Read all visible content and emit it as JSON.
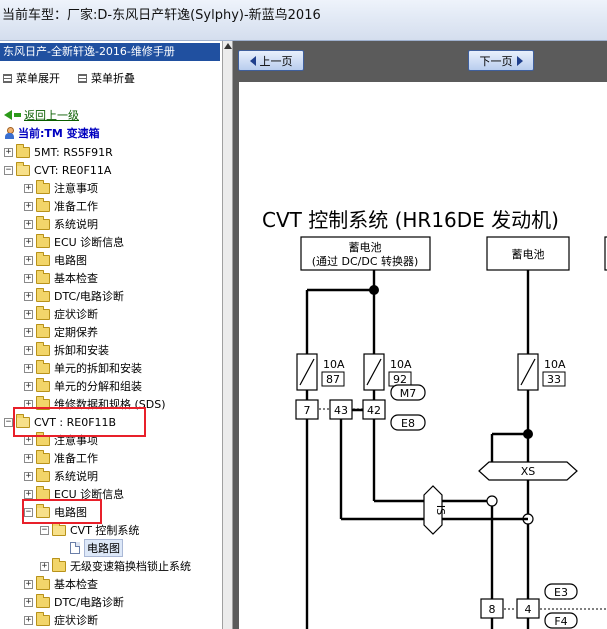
{
  "window": {
    "title": "当前车型：厂家:D-东风日产轩逸(Sylphy)-新蓝鸟2016"
  },
  "nav": {
    "manual_title": "东风日产-全新轩逸-2016-维修手册",
    "expand_label": "菜单展开",
    "collapse_label": "菜单折叠",
    "back_label": "返回上一级",
    "current_label": "当前:TM 变速箱",
    "tree": [
      {
        "label": "5MT: RS5F91R",
        "level": 0,
        "toggle": "+",
        "icon": "folder"
      },
      {
        "label": "CVT: RE0F11A",
        "level": 0,
        "toggle": "-",
        "icon": "folder-open"
      },
      {
        "label": "注意事项",
        "level": 1,
        "toggle": "+",
        "icon": "folder"
      },
      {
        "label": "准备工作",
        "level": 1,
        "toggle": "+",
        "icon": "folder"
      },
      {
        "label": "系统说明",
        "level": 1,
        "toggle": "+",
        "icon": "folder"
      },
      {
        "label": "ECU 诊断信息",
        "level": 1,
        "toggle": "+",
        "icon": "folder"
      },
      {
        "label": "电路图",
        "level": 1,
        "toggle": "+",
        "icon": "folder"
      },
      {
        "label": "基本检查",
        "level": 1,
        "toggle": "+",
        "icon": "folder"
      },
      {
        "label": "DTC/电路诊断",
        "level": 1,
        "toggle": "+",
        "icon": "folder"
      },
      {
        "label": "症状诊断",
        "level": 1,
        "toggle": "+",
        "icon": "folder"
      },
      {
        "label": "定期保养",
        "level": 1,
        "toggle": "+",
        "icon": "folder"
      },
      {
        "label": "拆卸和安装",
        "level": 1,
        "toggle": "+",
        "icon": "folder"
      },
      {
        "label": "单元的拆卸和安装",
        "level": 1,
        "toggle": "+",
        "icon": "folder"
      },
      {
        "label": "单元的分解和组装",
        "level": 1,
        "toggle": "+",
        "icon": "folder"
      },
      {
        "label": "维修数据和规格 (SDS)",
        "level": 1,
        "toggle": "+",
        "icon": "folder"
      },
      {
        "label": "CVT : RE0F11B",
        "level": 0,
        "toggle": "-",
        "icon": "folder-open"
      },
      {
        "label": "注意事项",
        "level": 1,
        "toggle": "+",
        "icon": "folder"
      },
      {
        "label": "准备工作",
        "level": 1,
        "toggle": "+",
        "icon": "folder"
      },
      {
        "label": "系统说明",
        "level": 1,
        "toggle": "+",
        "icon": "folder"
      },
      {
        "label": "ECU 诊断信息",
        "level": 1,
        "toggle": "+",
        "icon": "folder"
      },
      {
        "label": "电路图",
        "level": 1,
        "toggle": "-",
        "icon": "folder-open"
      },
      {
        "label": "CVT 控制系统",
        "level": 2,
        "toggle": "-",
        "icon": "folder-open"
      },
      {
        "label": "电路图",
        "level": 3,
        "toggle": "",
        "icon": "doc",
        "selected": true
      },
      {
        "label": "无级变速箱换档锁止系统",
        "level": 2,
        "toggle": "+",
        "icon": "folder"
      },
      {
        "label": "基本检查",
        "level": 1,
        "toggle": "+",
        "icon": "folder"
      },
      {
        "label": "DTC/电路诊断",
        "level": 1,
        "toggle": "+",
        "icon": "folder"
      },
      {
        "label": "症状诊断",
        "level": 1,
        "toggle": "+",
        "icon": "folder"
      }
    ]
  },
  "toolbar": {
    "prev_label": "上一页",
    "next_label": "下一页"
  },
  "diagram": {
    "title": "CVT 控制系统 (HR16DE 发动机)",
    "battery1_line1": "蓄电池",
    "battery1_line2": "(通过 DC/DC 转换器)",
    "battery2": "蓄电池",
    "fuse1_amp": "10A",
    "fuse1_no": "87",
    "fuse2_amp": "10A",
    "fuse2_no": "92",
    "fuse3_amp": "10A",
    "fuse3_no": "33",
    "pin_7": "7",
    "pin_43": "43",
    "pin_42": "42",
    "conn_m7": "M7",
    "conn_e8": "E8",
    "conn_xs": "XS",
    "conn_is": "IS",
    "pin_8": "8",
    "pin_4": "4",
    "conn_e3": "E3",
    "conn_f4": "F4"
  },
  "colors": {
    "title_bar": "#d4deee",
    "nav_header": "#2050a0",
    "highlight_box": "#e8202a",
    "content_bg": "#5b5b5b"
  }
}
